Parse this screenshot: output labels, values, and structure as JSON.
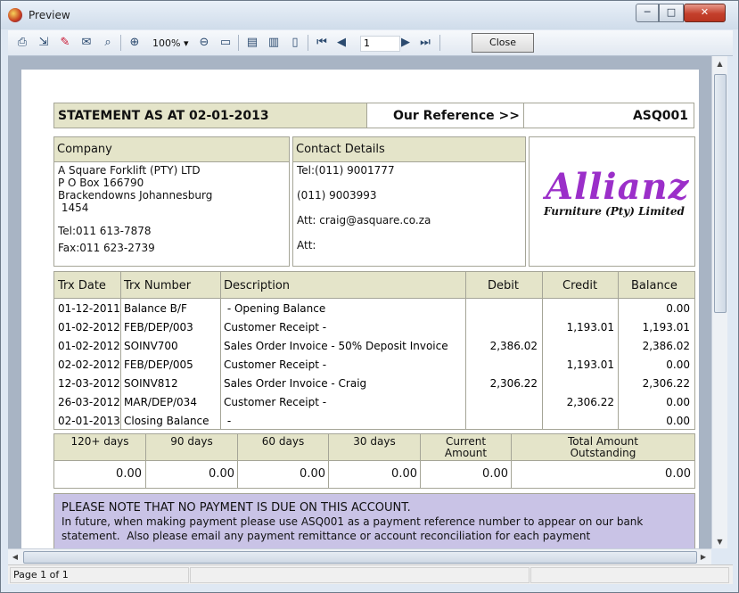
{
  "window": {
    "title": "Preview",
    "min_glyph": "─",
    "max_glyph": "□",
    "close_glyph": "✕"
  },
  "toolbar": {
    "zoom": "100%",
    "page": "1",
    "close_label": "Close"
  },
  "report": {
    "statement_title": "STATEMENT AS AT 02-01-2013",
    "our_reference_label": "Our Reference >>",
    "reference": "ASQ001",
    "company": {
      "header": "Company",
      "lines": [
        "A Square Forklift (PTY) LTD",
        "P O Box 166790",
        "Brackendowns Johannesburg",
        " 1454",
        "Tel:011 613-7878",
        "Fax:011 623-2739"
      ]
    },
    "contact": {
      "header": "Contact Details",
      "lines": [
        "Tel:(011) 9001777",
        "(011) 9003993",
        "Att: craig@asquare.co.za",
        "Att:"
      ]
    },
    "logo": {
      "name": "Allianz",
      "tagline": "Furniture (Pty) Limited",
      "color": "#9b2fc9"
    },
    "table": {
      "headers": [
        "Trx Date",
        "Trx Number",
        "Description",
        "Debit",
        "Credit",
        "Balance"
      ],
      "rows": [
        [
          "01-12-2011",
          "Balance B/F",
          " - Opening Balance",
          "",
          "",
          "0.00"
        ],
        [
          "01-02-2012",
          "FEB/DEP/003",
          "Customer Receipt -",
          "",
          "1,193.01",
          "1,193.01"
        ],
        [
          "01-02-2012",
          "SOINV700",
          "Sales Order Invoice - 50% Deposit Invoice",
          "2,386.02",
          "",
          "2,386.02"
        ],
        [
          "02-02-2012",
          "FEB/DEP/005",
          "Customer Receipt -",
          "",
          "1,193.01",
          "0.00"
        ],
        [
          "12-03-2012",
          "SOINV812",
          "Sales Order Invoice - Craig",
          "2,306.22",
          "",
          "2,306.22"
        ],
        [
          "26-03-2012",
          "MAR/DEP/034",
          "Customer Receipt -",
          "",
          "2,306.22",
          "0.00"
        ],
        [
          "02-01-2013",
          "Closing Balance",
          " -",
          "",
          "",
          "0.00"
        ]
      ]
    },
    "aging": {
      "headers": [
        "120+ days",
        "90 days",
        "60 days",
        "30 days",
        "Current\nAmount",
        "Total Amount\nOutstanding"
      ],
      "values": [
        "0.00",
        "0.00",
        "0.00",
        "0.00",
        "0.00",
        "0.00"
      ]
    },
    "note": {
      "line1": "PLEASE NOTE THAT NO PAYMENT IS DUE ON THIS ACCOUNT.",
      "line2": "In future, when making payment please use ASQ001 as a payment reference number to appear on our bank",
      "line3": "statement.  Also please email any payment remittance or account reconciliation for each payment",
      "bg": "#c9c3e6"
    }
  },
  "statusbar": {
    "page_text": "Page 1 of 1"
  },
  "colors": {
    "header_fill": "#e4e4c9",
    "border": "#a5a597"
  }
}
